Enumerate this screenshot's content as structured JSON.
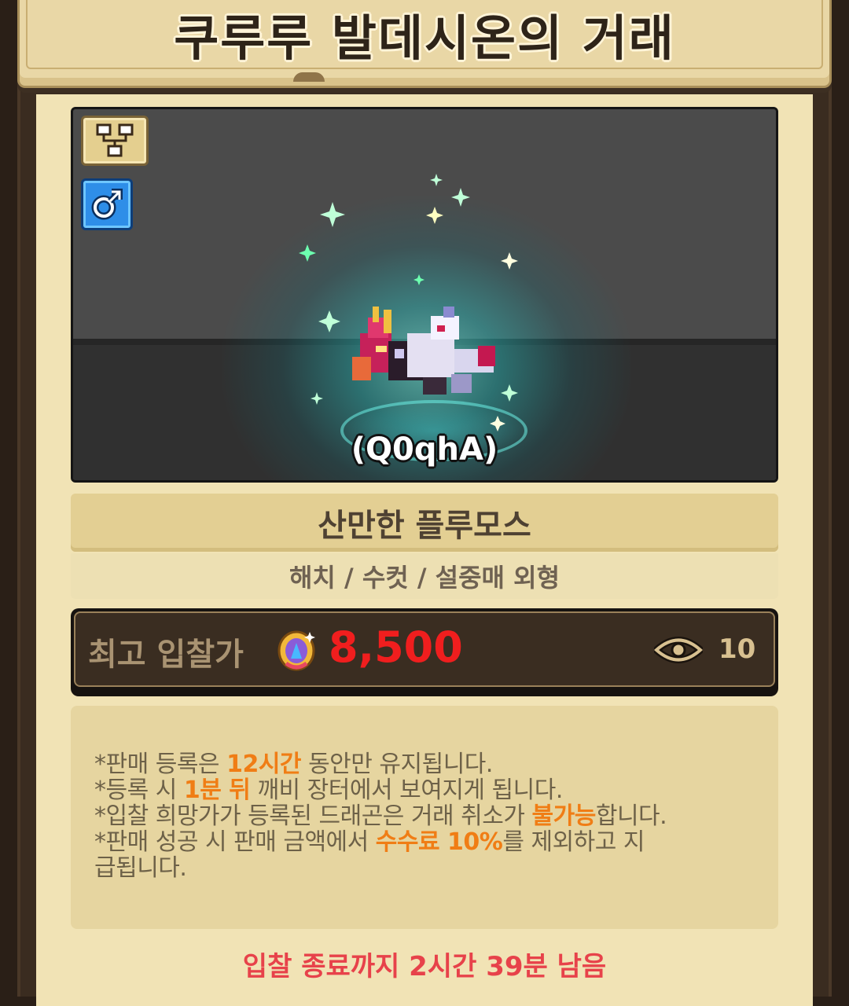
{
  "title": "쿠루루 발데시온의 거래",
  "preview": {
    "code": "(Q0qhA)",
    "badges": [
      "family-tree-icon",
      "male-gender-icon"
    ]
  },
  "dragon": {
    "name": "산만한 플루모스",
    "details": "해치 / 수컷 / 설중매 외형"
  },
  "bid": {
    "label": "최고 입찰가",
    "currency_icon": "gem-coin-icon",
    "value": "8,500",
    "views": "10"
  },
  "notice": {
    "line1": {
      "a": "*판매 등록은 ",
      "hl": "12시간",
      "b": " 동안만 유지됩니다."
    },
    "line2": {
      "a": "*등록 시 ",
      "hl": "1분 뒤",
      "b": " 깨비 장터에서 보여지게 됩니다."
    },
    "line3": {
      "a": "*입찰 희망가가 등록된 드래곤은 거래 취소가 ",
      "hl": "불가능",
      "b": "합니다."
    },
    "line4": {
      "a": "*판매 성공 시 판매 금액에서 ",
      "hl": "수수료 10%",
      "b": "를 제외하고 지급됩니다."
    }
  },
  "timer": "입찰 종료까지 2시간 39분 남음",
  "colors": {
    "accent_red": "#f01e1e",
    "highlight_orange": "#f07d15",
    "timer_red": "#e7424a"
  }
}
